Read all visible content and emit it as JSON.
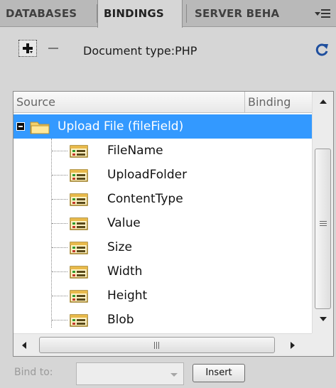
{
  "tabs": [
    {
      "label": "DATABASES"
    },
    {
      "label": "BINDINGS",
      "active": true
    },
    {
      "label": "SERVER BEHA"
    }
  ],
  "toolbar": {
    "doc_type_label": "Document type:PHP"
  },
  "tree": {
    "columns": {
      "source": "Source",
      "binding": "Binding"
    },
    "root": {
      "label": "Upload File (fileField)",
      "expanded": true,
      "selected": true,
      "icon": "folder-icon"
    },
    "fields": [
      {
        "label": "FileName",
        "icon": "field-icon"
      },
      {
        "label": "UploadFolder",
        "icon": "field-icon"
      },
      {
        "label": "ContentType",
        "icon": "field-icon"
      },
      {
        "label": "Value",
        "icon": "field-icon"
      },
      {
        "label": "Size",
        "icon": "field-icon"
      },
      {
        "label": "Width",
        "icon": "field-icon"
      },
      {
        "label": "Height",
        "icon": "field-icon"
      },
      {
        "label": "Blob",
        "icon": "field-icon"
      }
    ]
  },
  "bottom": {
    "bind_to_label": "Bind to:",
    "bind_to_value": "",
    "insert_label": "Insert"
  },
  "colors": {
    "selection": "#3399ff",
    "panel_bg": "#d6d6d6",
    "tab_bar_bg": "#b9b9b9"
  }
}
